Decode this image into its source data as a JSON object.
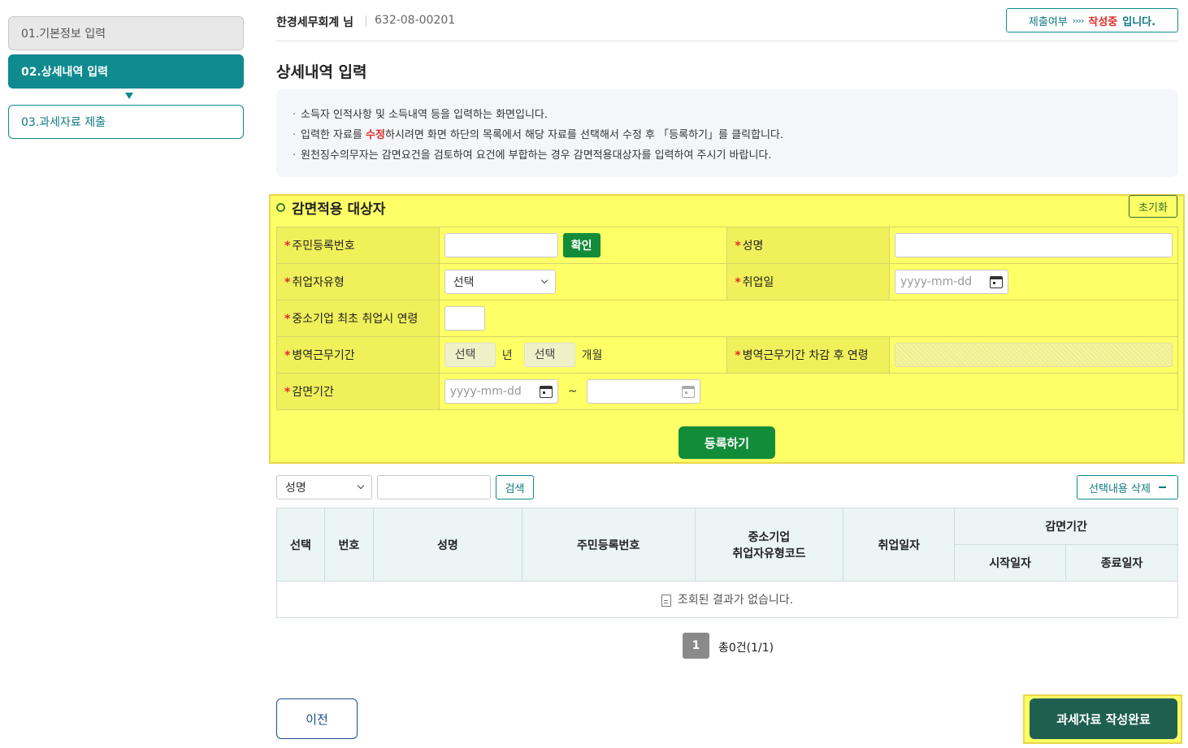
{
  "sidebar": {
    "steps": [
      {
        "label": "01.기본정보 입력"
      },
      {
        "label": "02.상세내역 입력"
      },
      {
        "label": "03.과세자료 제출"
      }
    ]
  },
  "header": {
    "user_name": "한경세무회계 님",
    "biz_number": "632-08-00201",
    "status_label": "제출여부",
    "status_arrows": "››››",
    "status_value": "작성중",
    "status_suffix": "입니다."
  },
  "page": {
    "title": "상세내역 입력",
    "info": [
      {
        "text": "소득자 인적사항 및 소득내역 등을 입력하는 화면입니다."
      },
      {
        "pre": "입력한 자료를 ",
        "highlight": "수정",
        "post": "하시려면 화면 하단의 목록에서 해당 자료를 선택해서 수정 후 「등록하기」를 클릭합니다."
      },
      {
        "text": "원천징수의무자는 감면요건을 검토하여 요건에 부합하는 경우 감면적용대상자를 입력하여 주시기 바랍니다."
      }
    ]
  },
  "form": {
    "section_title": "감면적용 대상자",
    "reset_label": "초기화",
    "required_mark": "*",
    "fields": {
      "rrn": {
        "label": "주민등록번호",
        "confirm_label": "확인"
      },
      "name": {
        "label": "성명"
      },
      "emp_type": {
        "label": "취업자유형",
        "value": "선택"
      },
      "emp_date": {
        "label": "취업일",
        "placeholder": "yyyy-mm-dd"
      },
      "age": {
        "label": "중소기업 최초 취업시 연령"
      },
      "military": {
        "label": "병역근무기간",
        "year_value": "선택",
        "year_unit": "년",
        "month_value": "선택",
        "month_unit": "개월"
      },
      "adj_age": {
        "label": "병역근무기간 차감 후 연령"
      },
      "period": {
        "label": "감면기간",
        "start_placeholder": "yyyy-mm-dd",
        "separator": "~"
      }
    },
    "register_label": "등록하기"
  },
  "search": {
    "field_value": "성명",
    "button_label": "검색",
    "delete_label": "선택내용 삭제"
  },
  "table": {
    "headers": {
      "select": "선택",
      "no": "번호",
      "name": "성명",
      "rrn": "주민등록번호",
      "type_code_1": "중소기업",
      "type_code_2": "취업자유형코드",
      "emp_date": "취업일자",
      "period": "감면기간",
      "start": "시작일자",
      "end": "종료일자"
    },
    "empty_message": "조회된 결과가 없습니다."
  },
  "pagination": {
    "current": "1",
    "summary": "총0건(1/1)"
  },
  "footer": {
    "prev_label": "이전",
    "complete_label": "과세자료 작성완료"
  }
}
